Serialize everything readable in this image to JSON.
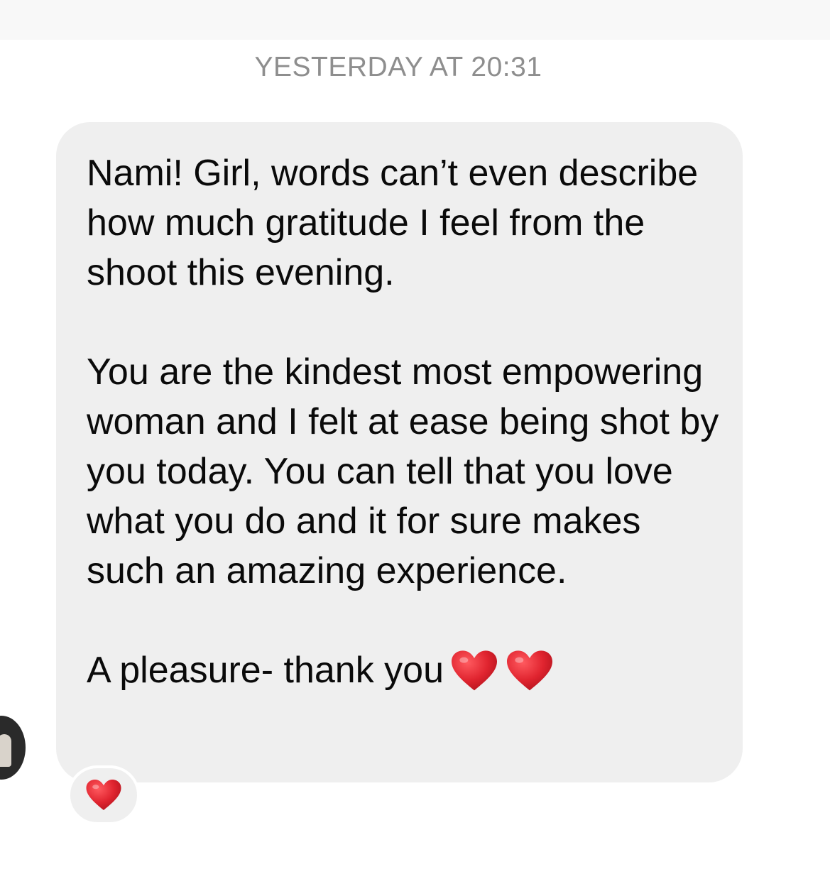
{
  "timestamp": "YESTERDAY AT 20:31",
  "message": {
    "paragraphs": [
      "Nami! Girl, words can’t even describe how much gratitude I feel from the shoot this evening.",
      "You are the kindest most empowering woman and I felt at ease being shot by you today. You can tell that you love what you do and it for sure makes such an amazing experience."
    ],
    "closing": "A pleasure- thank you",
    "closing_icons": [
      "red-heart-icon",
      "red-heart-icon"
    ]
  },
  "reaction": {
    "icon": "red-heart-icon"
  },
  "colors": {
    "bubble": "#efefef",
    "timestamp": "#8e8e8e",
    "heart": "#e0242f"
  }
}
